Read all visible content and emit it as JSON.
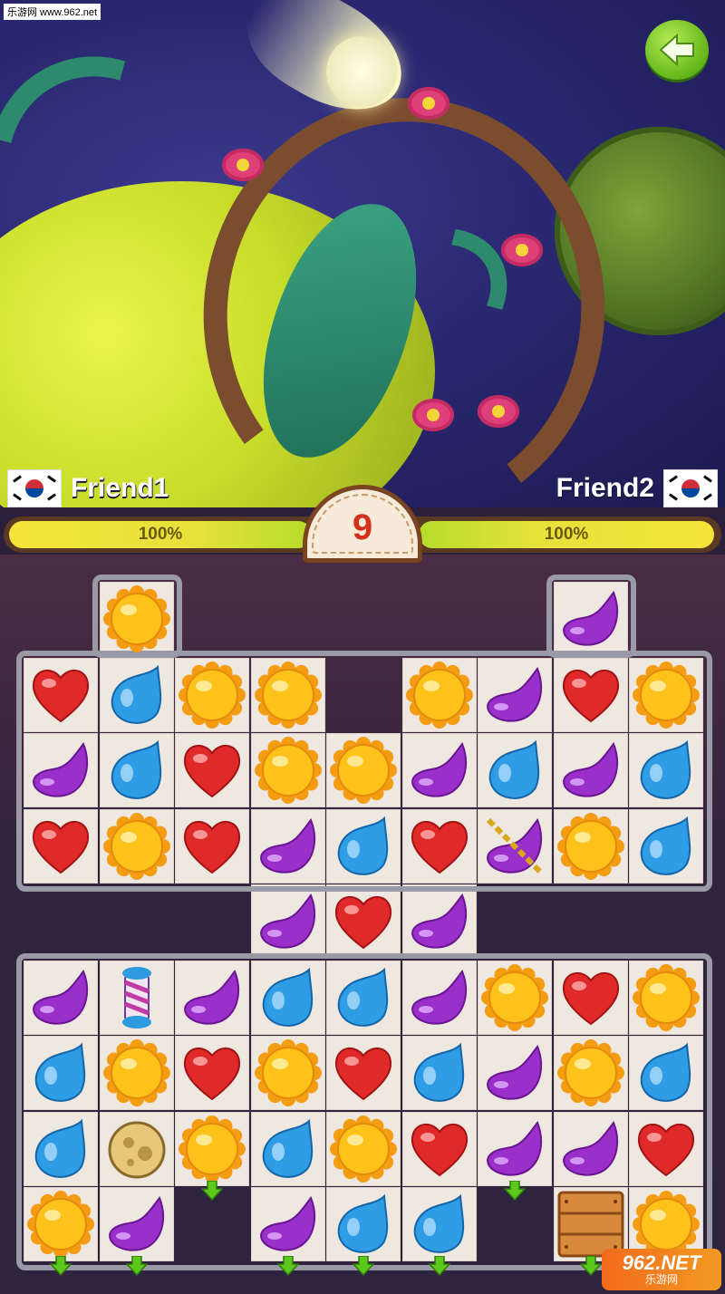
{
  "watermark": "乐游网 www.962.net",
  "players": {
    "left": {
      "name": "Friend1",
      "flag": "korea-flag",
      "hp_label": "100%",
      "hp": 1.0
    },
    "right": {
      "name": "Friend2",
      "flag": "korea-flag",
      "hp_label": "100%",
      "hp": 1.0
    }
  },
  "turns_left": "9",
  "back_button_icon": "back-arrow-icon",
  "logo": {
    "brand": "962.NET",
    "sub": "乐游网"
  },
  "colors": {
    "red": "#e02a2a",
    "blue": "#2f9ce6",
    "purple": "#9a2fc9",
    "sun": "#ffc21a",
    "arrow": "#5cc81c"
  },
  "board": {
    "columns": 9,
    "rows": [
      [
        "",
        "sun",
        "",
        "",
        "",
        "",
        "",
        "purple",
        ""
      ],
      [
        "red",
        "blue",
        "sun",
        "sun",
        "",
        "sun",
        "purple",
        "red",
        "sun"
      ],
      [
        "purple",
        "blue",
        "red",
        "sun",
        "sun",
        "purple",
        "blue",
        "purple",
        "blue"
      ],
      [
        "red",
        "sun",
        "red",
        "purple",
        "blue",
        "red",
        "purple-chained",
        "sun",
        "blue"
      ],
      [
        "",
        "",
        "",
        "purple",
        "red",
        "purple",
        "",
        "",
        ""
      ],
      [
        "purple",
        "striped-bomb",
        "purple",
        "blue",
        "blue",
        "purple",
        "sun",
        "red",
        "sun"
      ],
      [
        "blue",
        "sun",
        "red",
        "sun",
        "red",
        "blue",
        "purple",
        "sun",
        "blue"
      ],
      [
        "blue",
        "cheese-moon",
        "sun",
        "blue",
        "sun",
        "red",
        "purple",
        "purple",
        "red"
      ],
      [
        "sun",
        "purple",
        "",
        "purple",
        "blue",
        "blue",
        "",
        "wooden-crate",
        "sun"
      ]
    ],
    "drop_arrows": [
      [
        7,
        2
      ],
      [
        7,
        6
      ],
      [
        8,
        0
      ],
      [
        8,
        1
      ],
      [
        8,
        3
      ],
      [
        8,
        4
      ],
      [
        8,
        5
      ],
      [
        8,
        7
      ],
      [
        8,
        8
      ]
    ]
  }
}
